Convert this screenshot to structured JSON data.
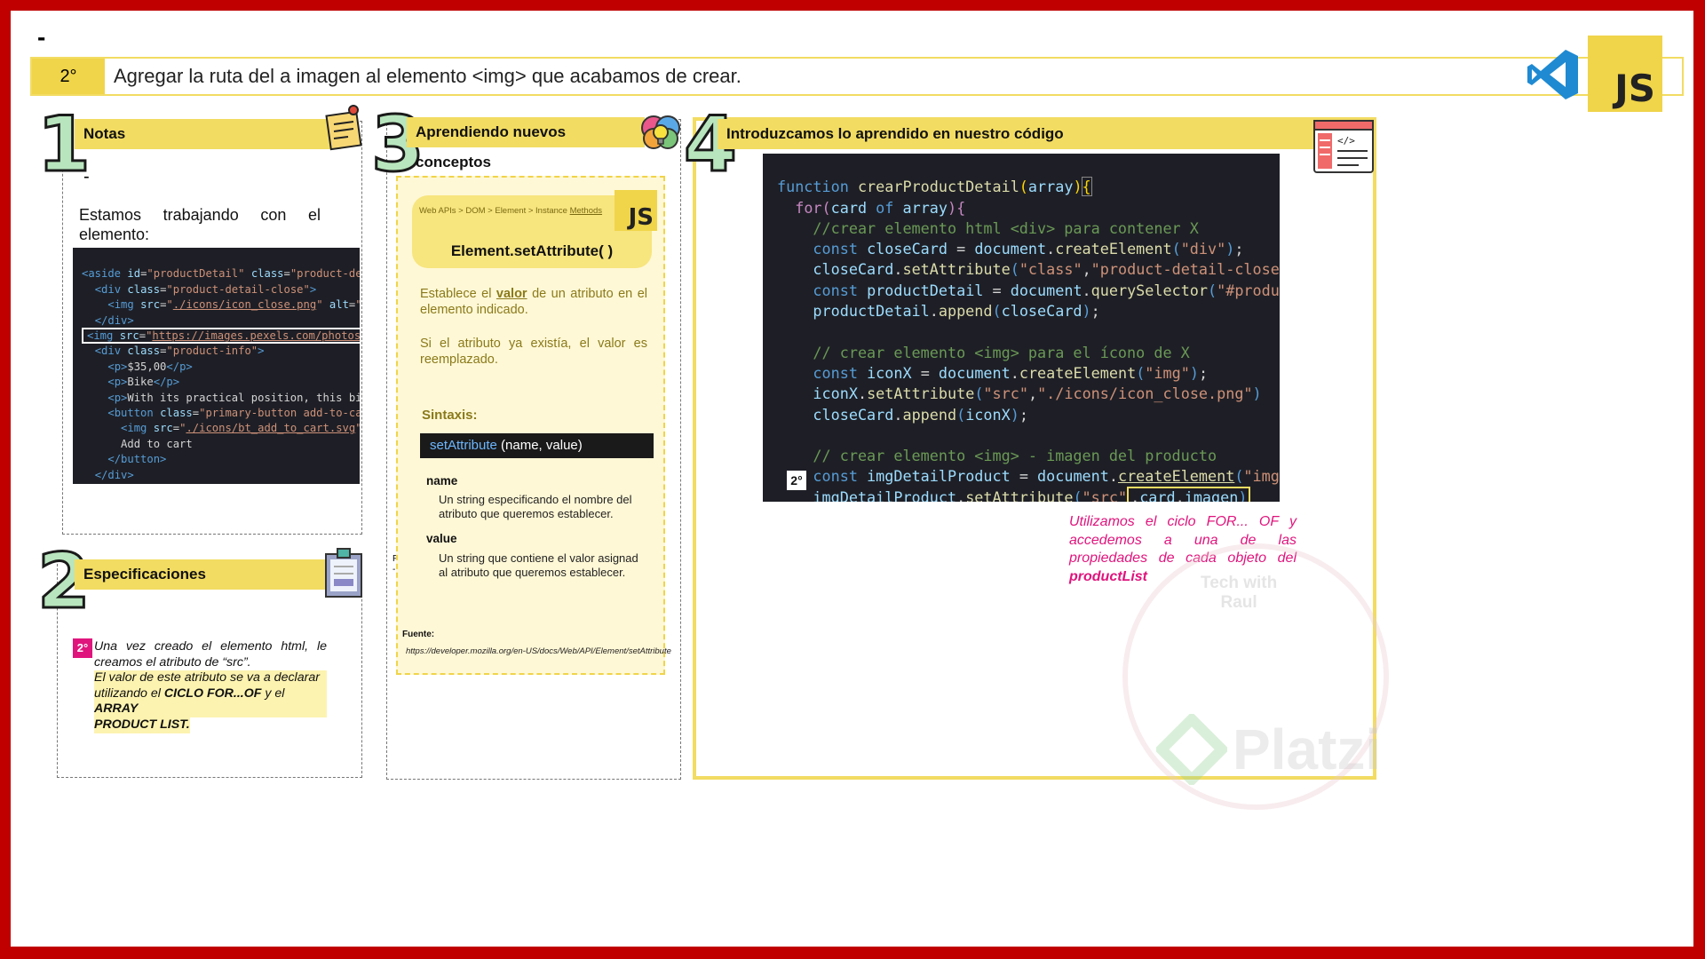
{
  "top_dash": "-",
  "step": {
    "badge": "2°",
    "text": "Agregar la ruta del a imagen al elemento <img> que acabamos de crear."
  },
  "logos": {
    "js": "JS",
    "vscode_icon": "vscode-icon"
  },
  "panel1": {
    "number": "1",
    "title": "Notas",
    "dash": "-",
    "intro_words": [
      "Estamos",
      "trabajando",
      "con",
      "el"
    ],
    "intro_line2": "elemento:"
  },
  "panel2": {
    "number": "2",
    "title": "Especificaciones",
    "badge": "2°",
    "line1": "Una vez creado el elemento html, le",
    "line2": "creamos el atributo de “src”.",
    "line3": "El valor de este atributo se va a declarar",
    "line4_a": "utilizando el ",
    "line4_b": "CICLO FOR...OF",
    "line4_c": " y el ",
    "line4_d": "ARRAY",
    "line5": "PRODUCT LIST."
  },
  "panel3": {
    "number": "3",
    "title": "Aprendiendo nuevos conceptos",
    "breadcrumb": "Web APIs > DOM > Element > Instance ",
    "breadcrumb_link": "Methods",
    "js_badge": "JS",
    "method": "Element.setAttribute( )",
    "desc1_a": "Establece el ",
    "desc1_b": "valor",
    "desc1_c": " de un atributo en el",
    "desc1_d": "elemento indicado.",
    "desc2_a": "Si el atributo ya existía, el valor es",
    "desc2_b": "reemplazado.",
    "syntax_label": "Sintaxis:",
    "syntax_fn": "setAttribute",
    "syntax_args": " (name, value)",
    "param1_name": "name",
    "param1_l1": "Un string especificando el nombre del",
    "param1_l2": "atributo que queremos establecer.",
    "param2_name": "value",
    "param2_l1": "Un string que contiene el valor asignad",
    "param2_l2": "al atributo que queremos establecer.",
    "source_label": "Fuente:",
    "source_url": "https://developer.mozilla.org/en-US/docs/Web/API/Element/setAttribute",
    "stray1": "F",
    "stray2": "-"
  },
  "panel4": {
    "number": "4",
    "title": "Introduzcamos lo aprendido en nuestro código",
    "marker": "2°",
    "note_l1": "Utilizamos el ciclo FOR... OF y",
    "note_l2": "accedemos a una de las",
    "note_l3": "propiedades de cada objeto del",
    "note_l4": "productList",
    "watermark_l1": "Tech with",
    "watermark_l2": "Raul",
    "brand": "Platzi"
  },
  "colors": {
    "accent_yellow": "#f2dc62",
    "frame_red": "#c00000",
    "pink": "#e0147d",
    "code_bg": "#1e1f26"
  }
}
